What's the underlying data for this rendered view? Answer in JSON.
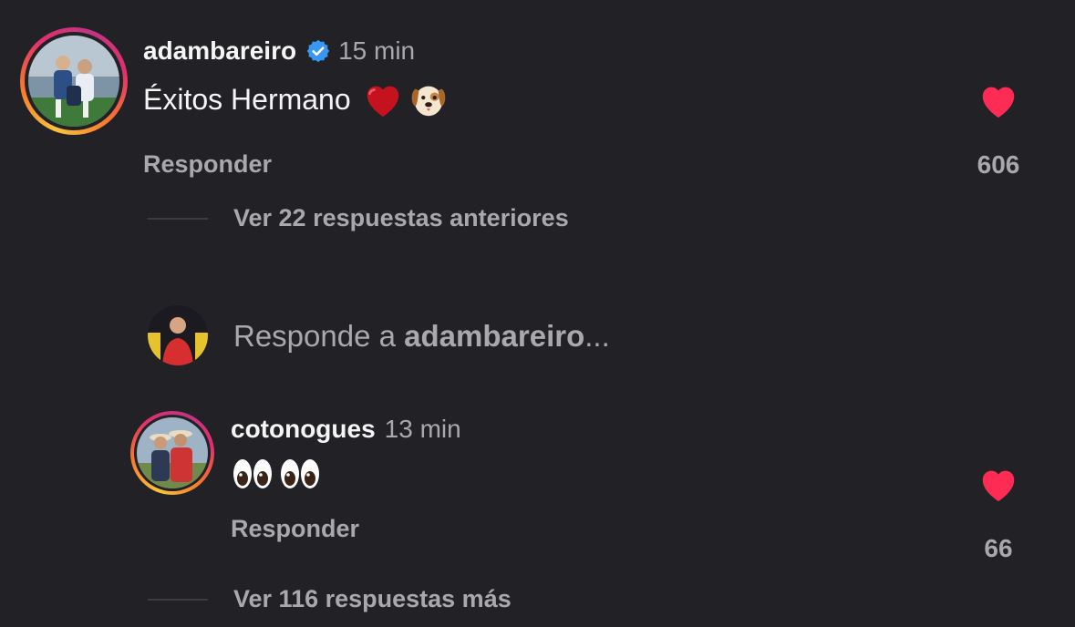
{
  "comments": [
    {
      "username": "adambareiro",
      "verified": true,
      "time": "15 min",
      "text": "Éxitos Hermano",
      "emoji": [
        "red-heart",
        "dog-face"
      ],
      "reply_label": "Responder",
      "likes": "606",
      "view_replies": "Ver 22 respuestas anteriores"
    },
    {
      "username": "cotonogues",
      "verified": false,
      "time": "13 min",
      "emoji": [
        "eyes",
        "eyes"
      ],
      "reply_label": "Responder",
      "likes": "66",
      "view_replies": "Ver 116 respuestas más"
    }
  ],
  "reply_box": {
    "prefix": "Responde a",
    "target": "adambareiro",
    "suffix": "..."
  },
  "colors": {
    "background": "#212126",
    "like_heart": "#fe2c55",
    "verified": "#3897f0",
    "muted_text": "#a8a8ad"
  }
}
